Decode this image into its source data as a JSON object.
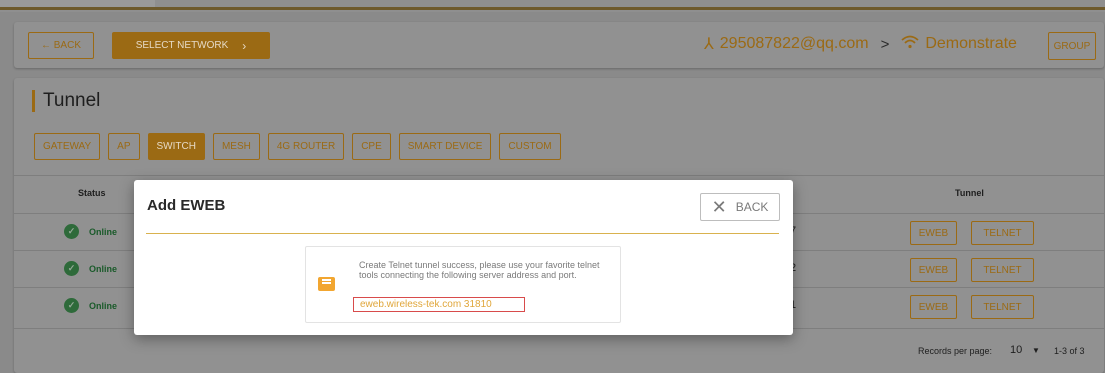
{
  "topbar": {
    "back_label": "← BACK",
    "select_network_label": "SELECT NETWORK",
    "select_network_chevron": "›",
    "account": "295087822@qq.com",
    "separator": ">",
    "network_name": "Demonstrate",
    "group_label": "GROUP"
  },
  "page": {
    "title": "Tunnel",
    "tabs": [
      {
        "label": "GATEWAY",
        "active": false
      },
      {
        "label": "AP",
        "active": false
      },
      {
        "label": "SWITCH",
        "active": true
      },
      {
        "label": "MESH",
        "active": false
      },
      {
        "label": "4G ROUTER",
        "active": false
      },
      {
        "label": "CPE",
        "active": false
      },
      {
        "label": "SMART DEVICE",
        "active": false
      },
      {
        "label": "CUSTOM",
        "active": false
      }
    ]
  },
  "table": {
    "headers": {
      "status": "Status",
      "tunnel": "Tunnel"
    },
    "rows": [
      {
        "status": "Online",
        "num": "7",
        "eweb": "EWEB",
        "telnet": "TELNET"
      },
      {
        "status": "Online",
        "num": "2",
        "eweb": "EWEB",
        "telnet": "TELNET"
      },
      {
        "status": "Online",
        "num": "1",
        "eweb": "EWEB",
        "telnet": "TELNET"
      }
    ],
    "footer": {
      "records_per_page_label": "Records per page:",
      "records_per_page_value": "10",
      "range": "1-3 of 3"
    }
  },
  "modal": {
    "title": "Add EWEB",
    "back_label": "BACK",
    "message": "Create Telnet tunnel success, please use your favorite telnet tools connecting the following server address and port.",
    "address": "eweb.wireless-tek.com 31810"
  },
  "colors": {
    "accent": "#9b6a14",
    "modal_accent": "#f2a630",
    "address_text": "#e0a63a",
    "address_border": "#d84b4b"
  }
}
